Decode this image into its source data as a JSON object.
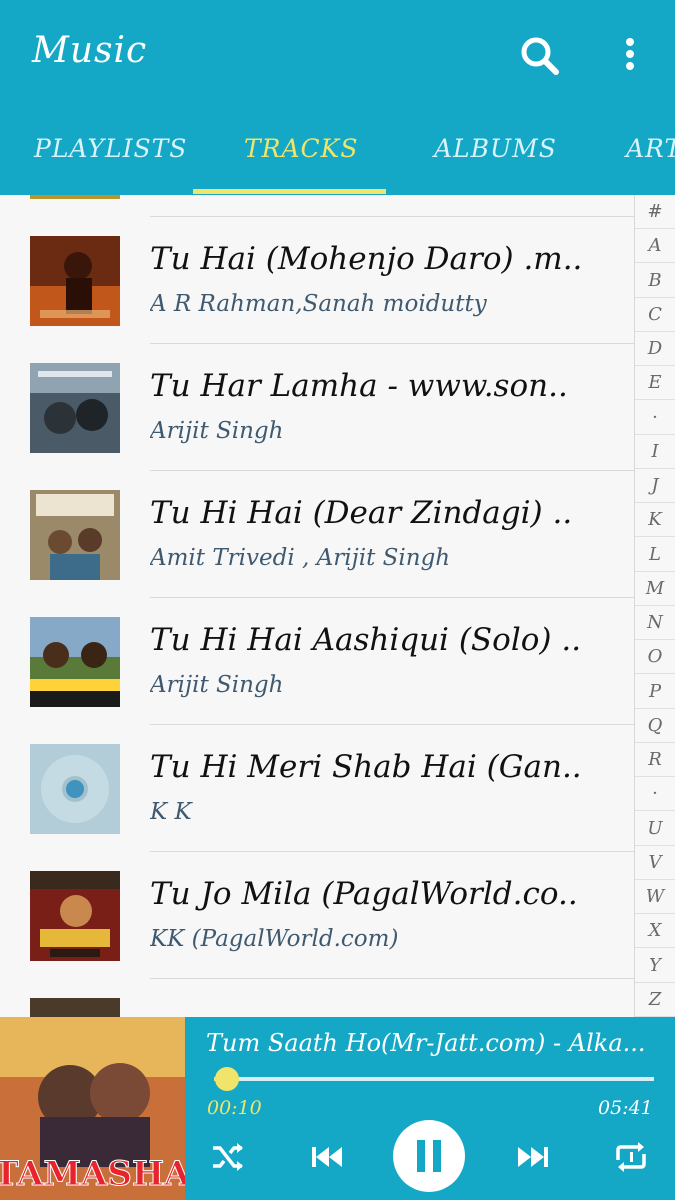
{
  "app": {
    "title": "Music"
  },
  "tabs": [
    {
      "label": "PLAYLISTS",
      "active": false
    },
    {
      "label": "TRACKS",
      "active": true
    },
    {
      "label": "ALBUMS",
      "active": false
    },
    {
      "label": "ART..",
      "active": false
    }
  ],
  "tracks": [
    {
      "title": "Tu Hai (Mohenjo Daro) .m..",
      "artist": "A R Rahman,Sanah moidutty"
    },
    {
      "title": "Tu Har Lamha -  www.son..",
      "artist": "Arijit Singh"
    },
    {
      "title": "Tu Hi Hai (Dear Zindagi) ..",
      "artist": "Amit Trivedi , Arijit Singh"
    },
    {
      "title": "Tu Hi Hai Aashiqui (Solo) ..",
      "artist": "Arijit Singh"
    },
    {
      "title": "Tu Hi Meri Shab Hai (Gan..",
      "artist": "K K"
    },
    {
      "title": "Tu Jo Mila (PagalWorld.co..",
      "artist": "KK (PagalWorld.com)"
    }
  ],
  "index": [
    "#",
    "A",
    "B",
    "C",
    "D",
    "E",
    "·",
    "I",
    "J",
    "K",
    "L",
    "M",
    "N",
    "O",
    "P",
    "Q",
    "R",
    "·",
    "U",
    "V",
    "W",
    "X",
    "Y",
    "Z"
  ],
  "player": {
    "title": "Tum Saath Ho(Mr-Jatt.com) - Alka...",
    "current_time": "00:10",
    "total_time": "05:41",
    "progress": 0.03,
    "album_art_label": "TAMASHA"
  },
  "colors": {
    "accent": "#14a8c6",
    "highlight": "#f1e46a"
  }
}
